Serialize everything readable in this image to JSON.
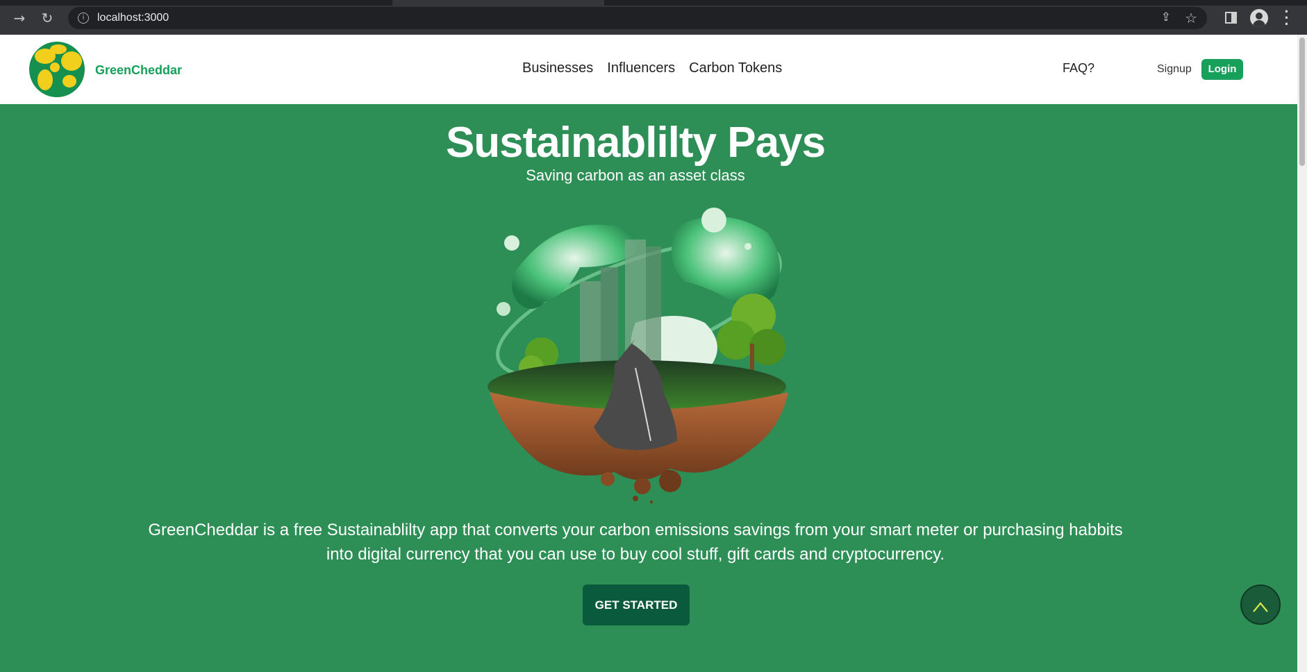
{
  "browser": {
    "url": "localhost:3000"
  },
  "nav": {
    "brand": "GreenCheddar",
    "links": [
      "Businesses",
      "Influencers",
      "Carbon Tokens"
    ],
    "faq": "FAQ?",
    "signup": "Signup",
    "login": "Login"
  },
  "hero": {
    "title": "Sustainablilty Pays",
    "subtitle": "Saving carbon as an asset class",
    "description_line1": "GreenCheddar is a free Sustainablilty app that converts your carbon emissions savings from your smart meter or purchasing habbits",
    "description_line2": "into digital currency that you can use to buy cool stuff, gift cards and cryptocurrency.",
    "cta": "GET STARTED"
  },
  "colors": {
    "hero_bg": "#2d8f56",
    "brand_green": "#16a05a",
    "cta_bg": "#0a5a3d"
  }
}
